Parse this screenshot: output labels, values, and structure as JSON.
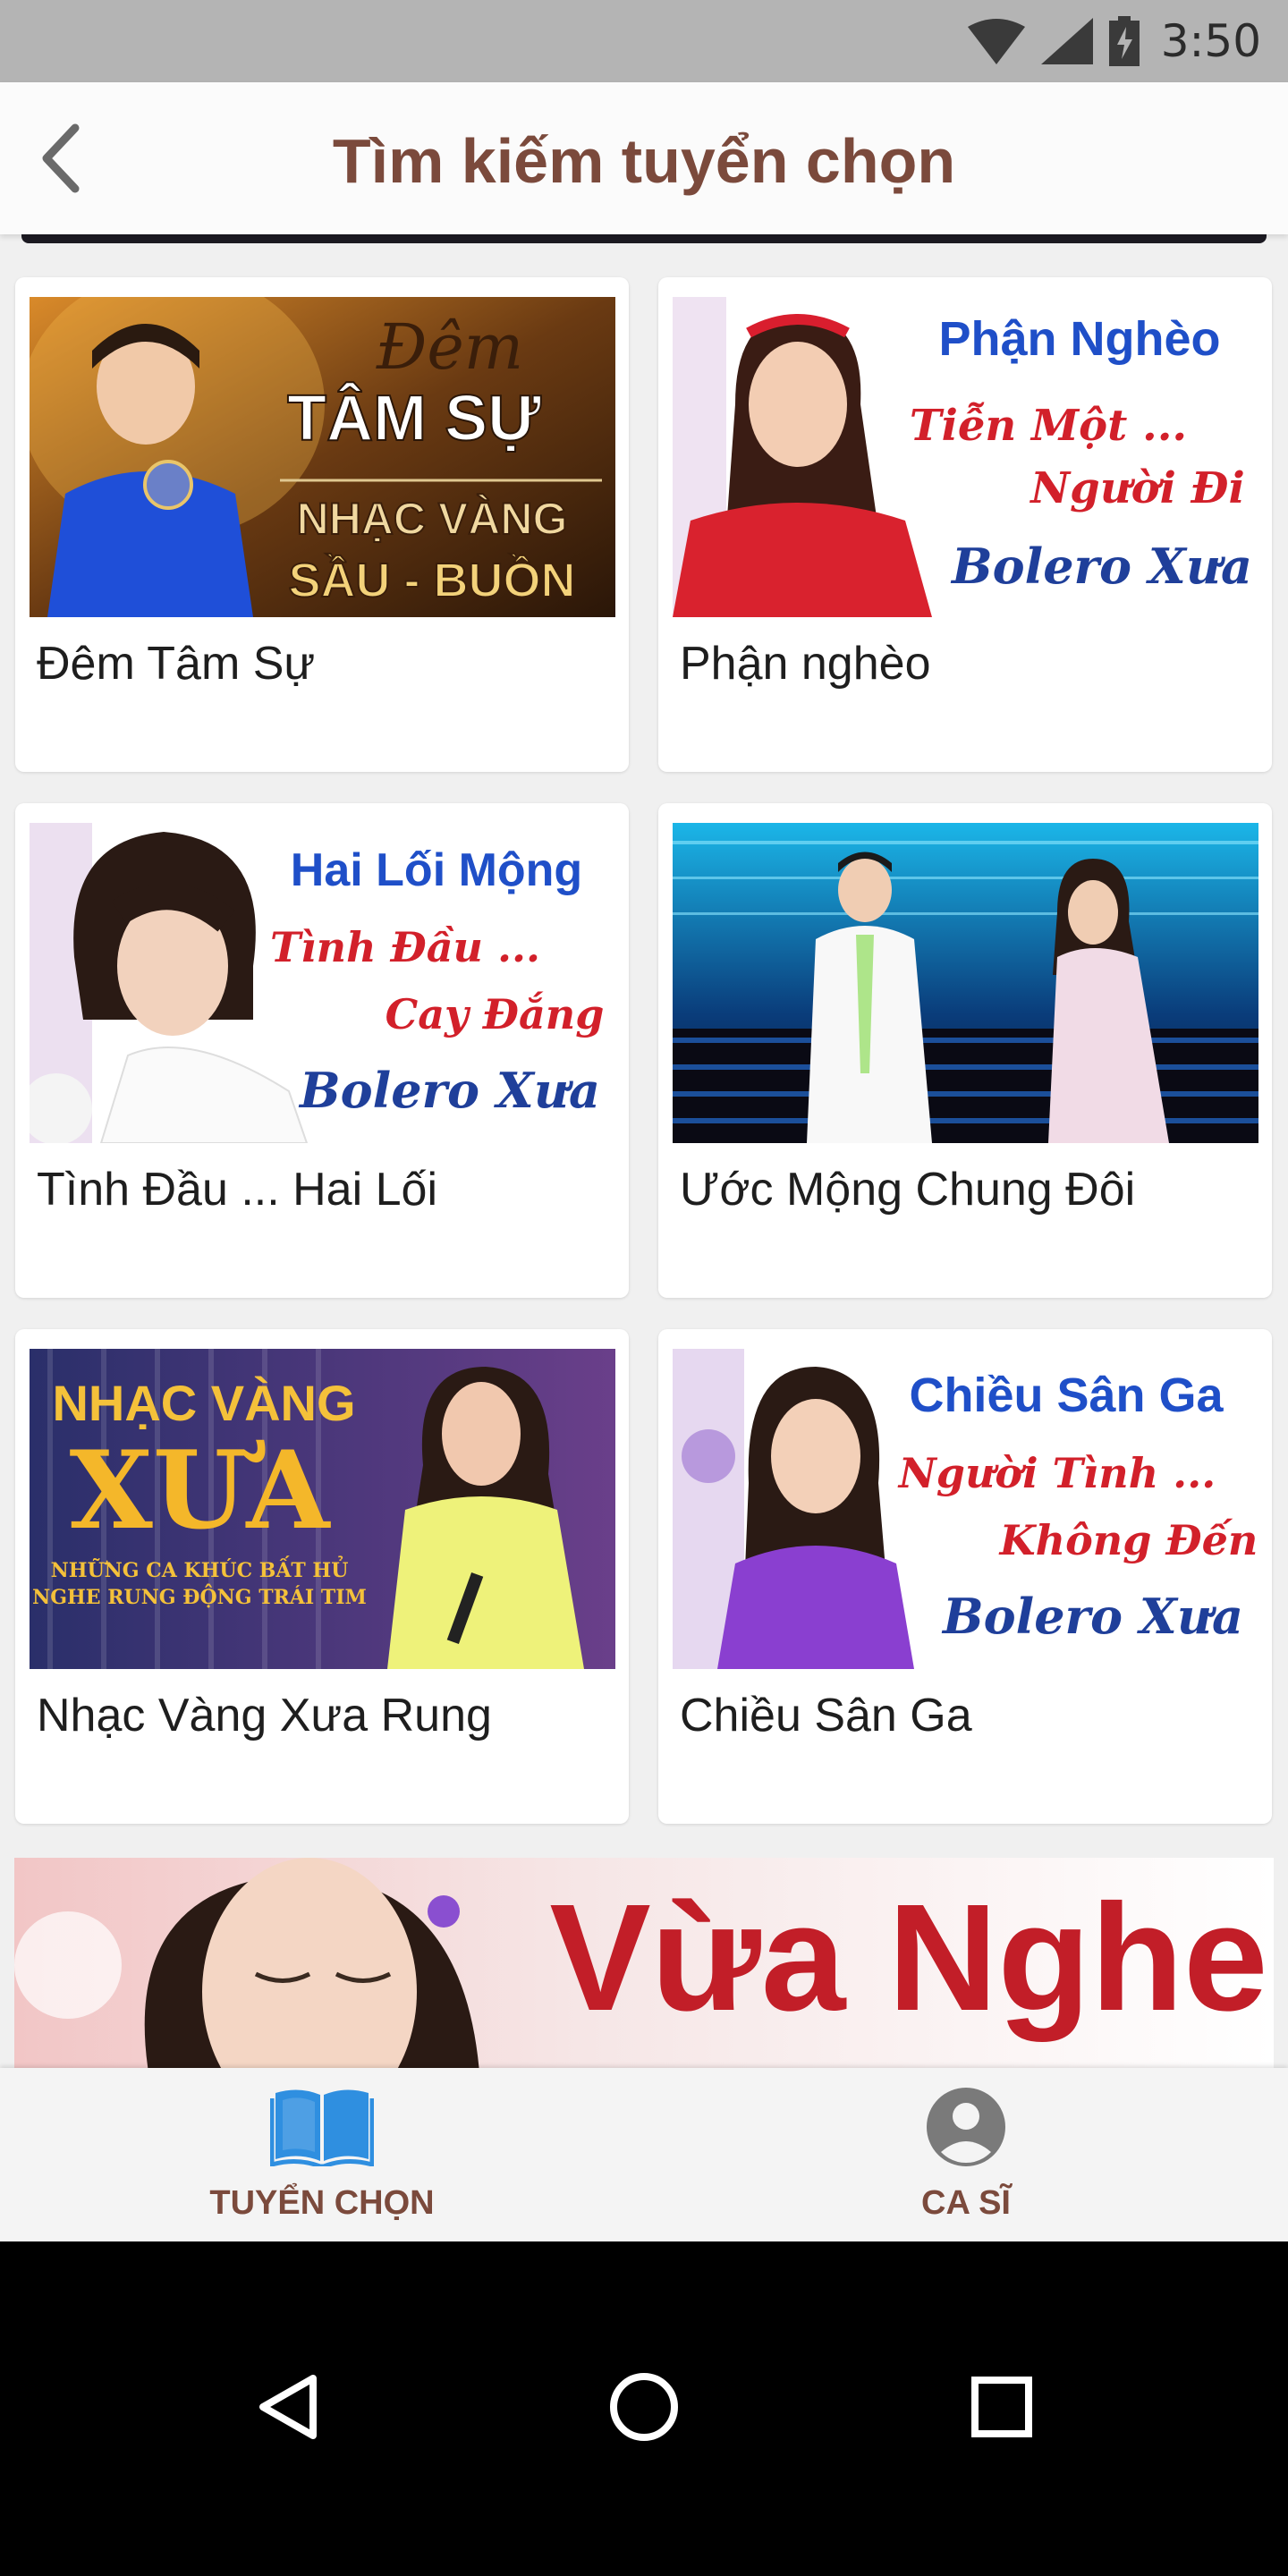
{
  "status_bar": {
    "time": "3:50"
  },
  "header": {
    "title": "Tìm kiếm tuyển chọn"
  },
  "cards": [
    {
      "title": "Đêm Tâm Sự",
      "thumb_lines": [
        "Đêm",
        "TÂM SỰ",
        "NHẠC VÀNG",
        "SẦU - BUỒN"
      ]
    },
    {
      "title": "Phận nghèo",
      "thumb_lines": [
        "Phận Nghèo",
        "Tiễn Một ...",
        "Người Đi",
        "Bolero Xưa"
      ]
    },
    {
      "title": "Tình Đầu ... Hai Lối",
      "thumb_lines": [
        "Hai Lối Mộng",
        "Tình Đầu ...",
        "Cay Đắng",
        "Bolero Xưa"
      ]
    },
    {
      "title": "Ước Mộng Chung Đôi",
      "thumb_lines": []
    },
    {
      "title": "Nhạc Vàng Xưa Rung",
      "thumb_lines": [
        "NHẠC VÀNG",
        "XƯA",
        "NHỮNG CA KHÚC BẤT HỦ",
        "NGHE RUNG ĐỘNG TRÁI TIM"
      ]
    },
    {
      "title": "Chiều Sân Ga",
      "thumb_lines": [
        "Chiều Sân Ga",
        "Người Tình ...",
        "Không Đến",
        "Bolero Xưa"
      ]
    }
  ],
  "banner": {
    "text": "Vừa Nghe"
  },
  "bottom_nav": {
    "tabs": [
      {
        "label": "TUYỂN CHỌN",
        "icon": "book-icon"
      },
      {
        "label": "CA SĨ",
        "icon": "person-icon"
      }
    ]
  },
  "colors": {
    "accent": "#7b4a3c",
    "tab_icon_active": "#2f8fe0",
    "tab_icon_inactive": "#7a7a7a"
  }
}
